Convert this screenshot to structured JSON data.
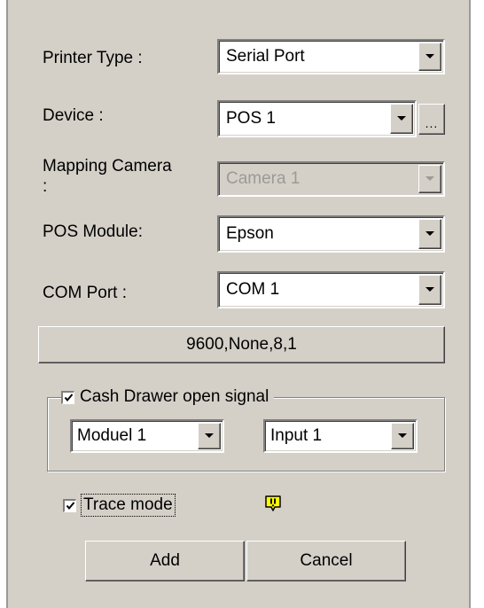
{
  "printer_type": {
    "label": "Printer Type :",
    "value": "Serial Port"
  },
  "device": {
    "label": "Device :",
    "value": "POS 1",
    "browse_label": "..."
  },
  "mapping_camera": {
    "label": "Mapping Camera :",
    "value": "Camera 1",
    "disabled": true
  },
  "pos_module": {
    "label": "POS Module:",
    "value": "Epson"
  },
  "com_port": {
    "label": "COM Port :",
    "value": "COM 1"
  },
  "com_settings_button": "9600,None,8,1",
  "cash_drawer": {
    "label": "Cash Drawer open signal",
    "checked": true,
    "module_value": "Moduel 1",
    "input_value": "Input 1"
  },
  "trace_mode": {
    "label": "Trace mode",
    "checked": true
  },
  "buttons": {
    "add": "Add",
    "cancel": "Cancel"
  },
  "icons": {
    "dropdown": "dropdown-arrow-icon",
    "checkmark": "checkmark-icon",
    "warning": "warning-icon"
  },
  "colors": {
    "dialog_bg": "#d4d0c8",
    "warning": "#ffff00"
  }
}
